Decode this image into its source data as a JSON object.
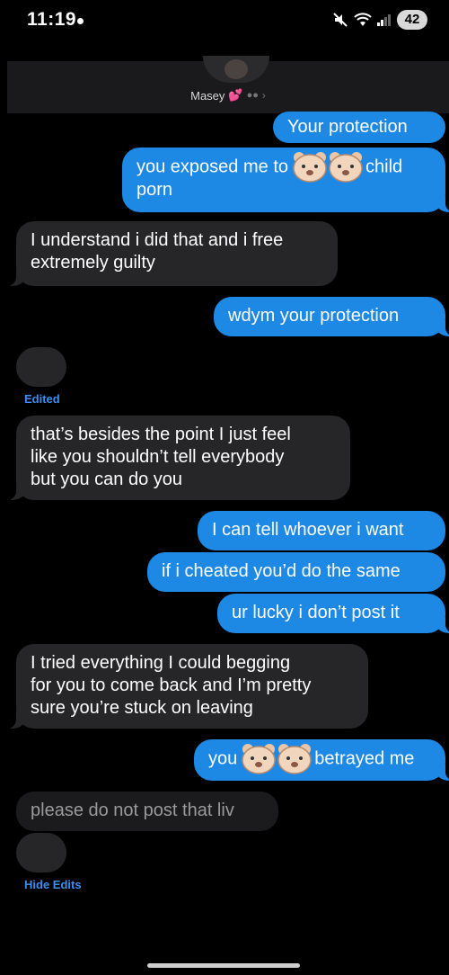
{
  "status_bar": {
    "time": "11:19",
    "battery": "42",
    "icons": [
      "mute-icon",
      "wifi-icon",
      "signal-icon",
      "battery-icon"
    ]
  },
  "header": {
    "contact_name": "Masey",
    "emoji_icons": [
      "sparkling-heart-icon",
      "paw-prints-icon",
      "chevron-right-icon"
    ]
  },
  "messages": [
    {
      "from": "me",
      "text": "Your protection"
    },
    {
      "from": "me",
      "text_before": "you exposed me to",
      "text_after": "child",
      "text_line2": "porn",
      "inline_icon": "bear-emoji-icon"
    },
    {
      "from": "them",
      "line1": "I understand i did that and i free",
      "line2": "extremely guilty"
    },
    {
      "from": "me",
      "text": "wdym your protection"
    },
    {
      "from": "them",
      "text": "",
      "edit_label": "Edited"
    },
    {
      "from": "them",
      "line1": "that’s besides the point I just feel",
      "line2": "like you shouldn’t tell everybody",
      "line3": "but you can do you"
    },
    {
      "from": "me",
      "text": "I can tell whoever i want"
    },
    {
      "from": "me",
      "text": "if i cheated you’d do the same"
    },
    {
      "from": "me",
      "text": "ur lucky i don’t post it"
    },
    {
      "from": "them",
      "line1": "I tried everything I could begging",
      "line2": "for you to come back and I’m pretty",
      "line3": "sure you’re stuck on leaving"
    },
    {
      "from": "me",
      "text_before": "you",
      "text_after": "betrayed me",
      "inline_icon": "bear-emoji-icon"
    },
    {
      "from": "them",
      "text": "please do not post that liv"
    },
    {
      "from": "them",
      "text": "",
      "edit_label": "Hide Edits"
    }
  ],
  "colors": {
    "sent_bubble": "#1e88e5",
    "received_bubble": "#262628",
    "edit_label": "#3d8ef0",
    "background": "#000000"
  }
}
